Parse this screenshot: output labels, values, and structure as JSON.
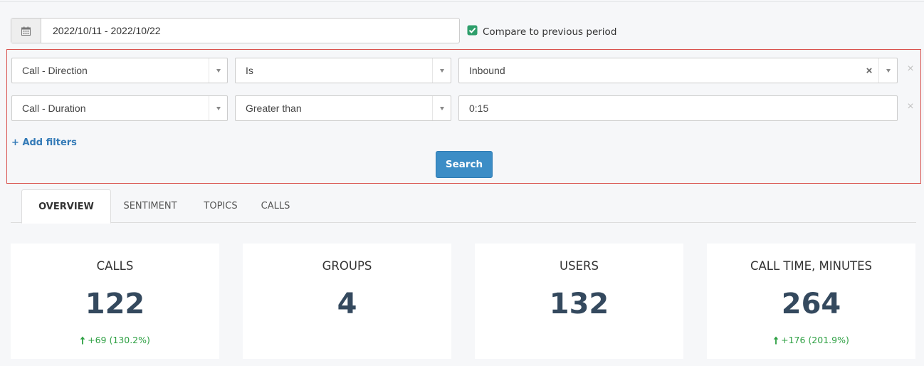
{
  "date_range": {
    "value": "2022/10/11 - 2022/10/22"
  },
  "compare": {
    "label": "Compare to previous period",
    "checked": true
  },
  "filters": [
    {
      "field": "Call - Direction",
      "operator": "Is",
      "value": "Inbound"
    },
    {
      "field": "Call - Duration",
      "operator": "Greater than",
      "value": "0:15"
    }
  ],
  "add_filters_label": "Add filters",
  "search_label": "Search",
  "tabs": [
    {
      "label": "OVERVIEW",
      "active": true
    },
    {
      "label": "SENTIMENT",
      "active": false
    },
    {
      "label": "TOPICS",
      "active": false
    },
    {
      "label": "CALLS",
      "active": false
    }
  ],
  "stats": [
    {
      "title": "CALLS",
      "value": "122",
      "delta": "+69 (130.2%)"
    },
    {
      "title": "GROUPS",
      "value": "4",
      "delta": ""
    },
    {
      "title": "USERS",
      "value": "132",
      "delta": ""
    },
    {
      "title": "CALL TIME, MINUTES",
      "value": "264",
      "delta": "+176 (201.9%)"
    }
  ],
  "colors": {
    "accent": "#3c8dc6",
    "highlight_border": "#d9534f",
    "positive": "#2ea043",
    "compare_check": "#2e9e6b",
    "stat_value": "#34495e"
  }
}
